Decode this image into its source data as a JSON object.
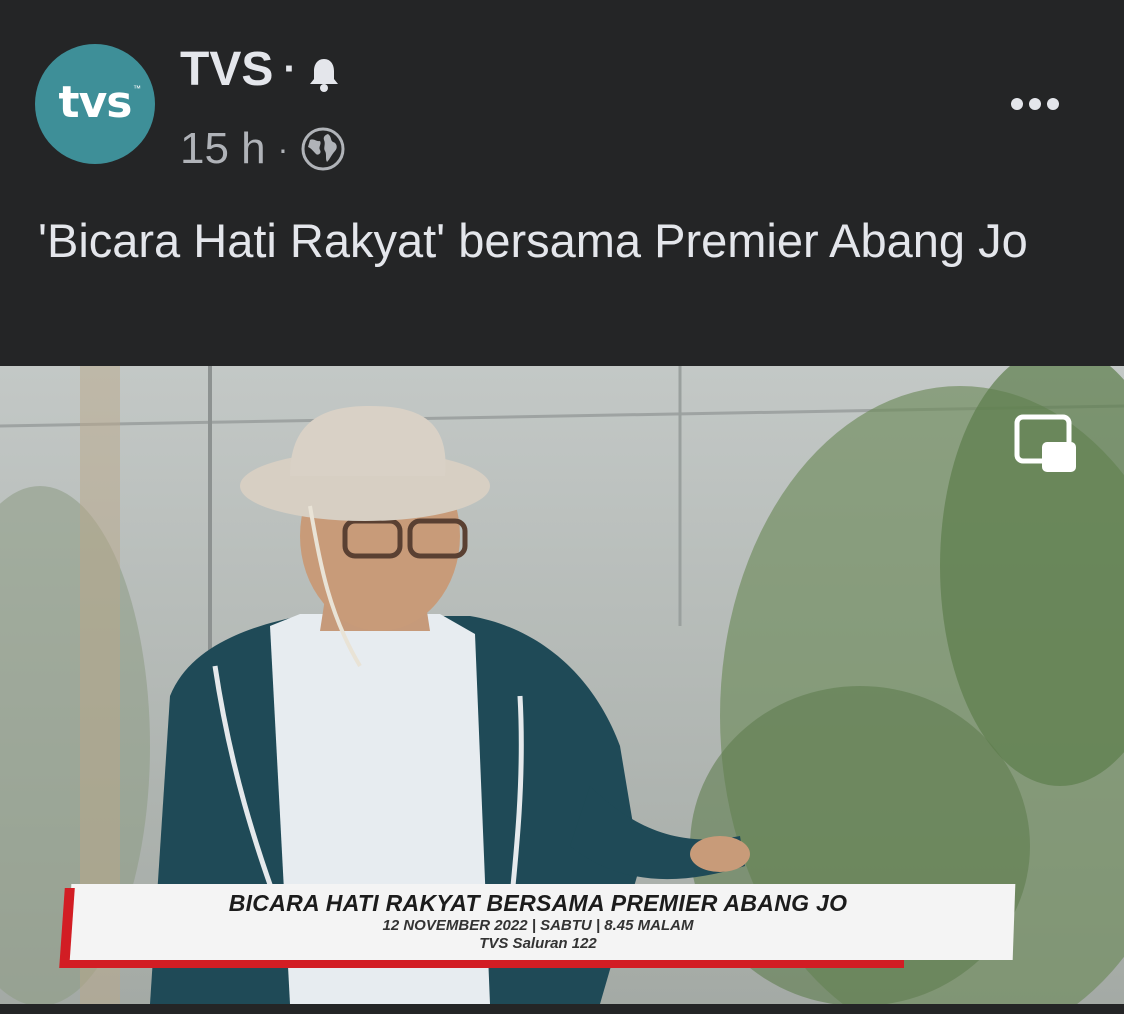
{
  "post": {
    "page_name": "TVS",
    "avatar_text": "tvs",
    "avatar_tm": "™",
    "time": "15 h",
    "separator": "·",
    "audience_icon": "globe-icon",
    "notification_icon": "bell-icon",
    "more_icon": "more-horizontal-icon",
    "caption": "'Bicara Hati Rakyat' bersama Premier Abang Jo"
  },
  "video": {
    "pip_icon": "picture-in-picture-icon",
    "lower_third": {
      "title": "BICARA HATI RAKYAT BERSAMA PREMIER ABANG JO",
      "date_line": "12 NOVEMBER 2022 | SABTU | 8.45 MALAM",
      "channel_line": "TVS Saluran 122"
    }
  },
  "colors": {
    "background": "#242526",
    "avatar": "#3e8f98",
    "accent_red": "#d21d24",
    "text_primary": "#e4e6eb",
    "text_secondary": "#b0b3b8"
  }
}
